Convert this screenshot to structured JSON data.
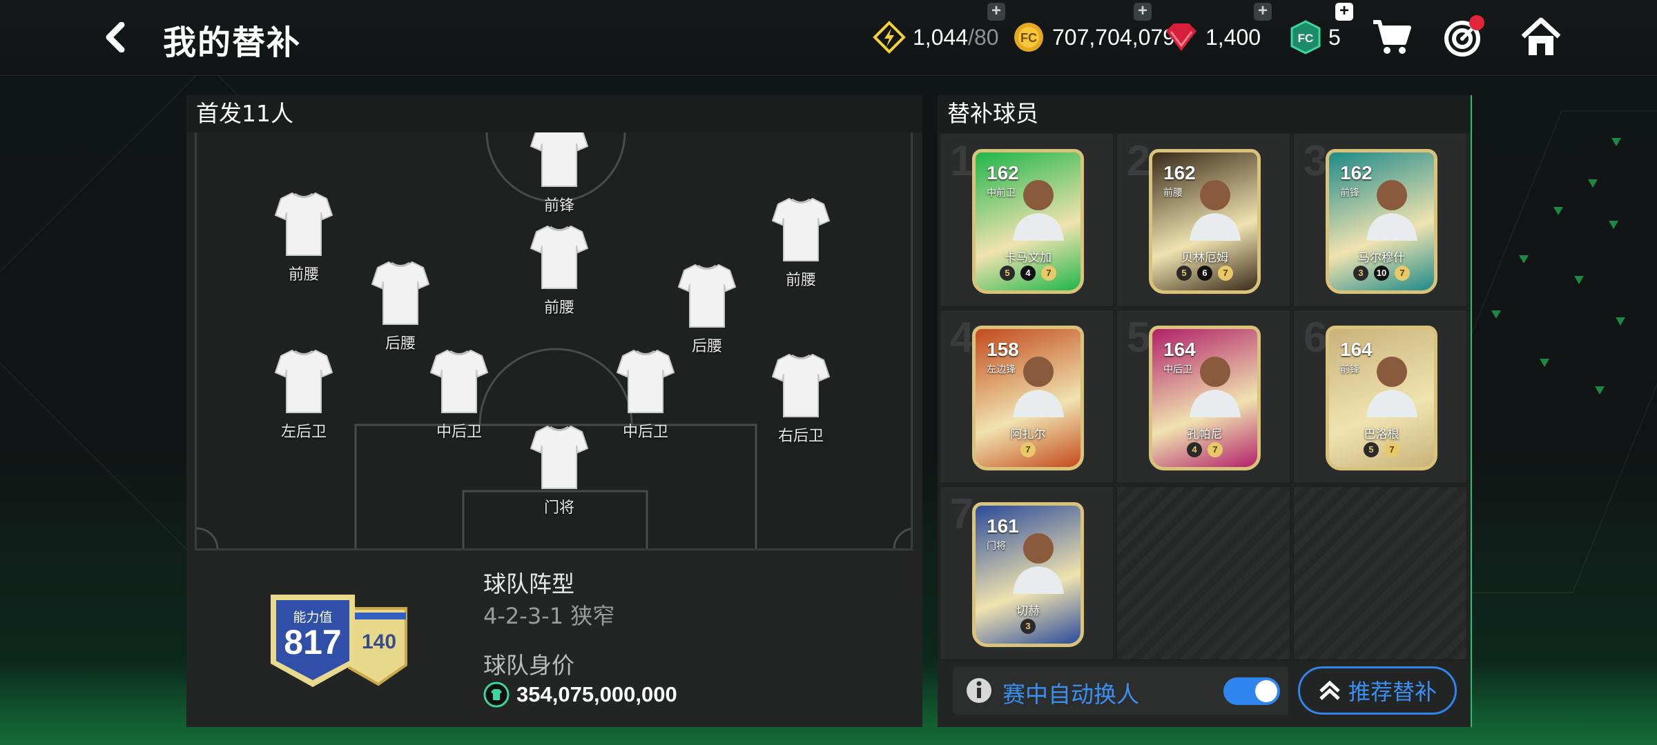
{
  "header": {
    "title": "我的替补"
  },
  "currency": {
    "energy": "1,044",
    "energy_max": "/80",
    "coins": "707,704,079",
    "gems": "1,400",
    "tokens": "5"
  },
  "lineup": {
    "title": "首发11人",
    "players": [
      {
        "label": "前锋"
      },
      {
        "label": "前腰"
      },
      {
        "label": "前腰"
      },
      {
        "label": "前腰"
      },
      {
        "label": "后腰"
      },
      {
        "label": "后腰"
      },
      {
        "label": "左后卫"
      },
      {
        "label": "中后卫"
      },
      {
        "label": "中后卫"
      },
      {
        "label": "右后卫"
      },
      {
        "label": "门将"
      }
    ],
    "ability_label": "能力值",
    "ability_value": "817",
    "ability_bonus": "140",
    "formation_label": "球队阵型",
    "formation_value": "4-2-3-1 狭窄",
    "value_label": "球队身价",
    "value_amount": "354,075,000,000"
  },
  "subs": {
    "title": "替补球员",
    "slots": [
      {
        "num": "1",
        "ovr": "162",
        "pos": "中前卫",
        "name": "卡马文加",
        "b1": "5",
        "b2": "7",
        "rank": "4",
        "color": "#1fb64a"
      },
      {
        "num": "2",
        "ovr": "162",
        "pos": "前腰",
        "name": "贝林厄姆",
        "b1": "5",
        "b2": "7",
        "rank": "6",
        "color": "#3a2a1a"
      },
      {
        "num": "3",
        "ovr": "162",
        "pos": "前锋",
        "name": "马尔穆什",
        "b1": "3",
        "b2": "7",
        "rank": "10",
        "color": "#1e8a8a"
      },
      {
        "num": "4",
        "ovr": "158",
        "pos": "左边锋",
        "name": "阿扎尔",
        "b1": "",
        "b2": "7",
        "rank": "",
        "color": "#c44a1c"
      },
      {
        "num": "5",
        "ovr": "164",
        "pos": "中后卫",
        "name": "孔帕尼",
        "b1": "4",
        "b2": "7",
        "rank": "",
        "color": "#b2206a"
      },
      {
        "num": "6",
        "ovr": "164",
        "pos": "前锋",
        "name": "巴洛根",
        "b1": "5",
        "b2": "7",
        "rank": "",
        "color": "#c9b27a"
      },
      {
        "num": "7",
        "ovr": "161",
        "pos": "门将",
        "name": "切赫",
        "b1": "3",
        "b2": "",
        "rank": "",
        "color": "#2b4b9a"
      }
    ],
    "auto_sub_label": "赛中自动换人",
    "auto_sub_on": true,
    "recommend_label": "推荐替补"
  },
  "colors": {
    "accent_blue": "#3a8ff0",
    "toggle": "#2f86ee",
    "panel": "#232525"
  }
}
